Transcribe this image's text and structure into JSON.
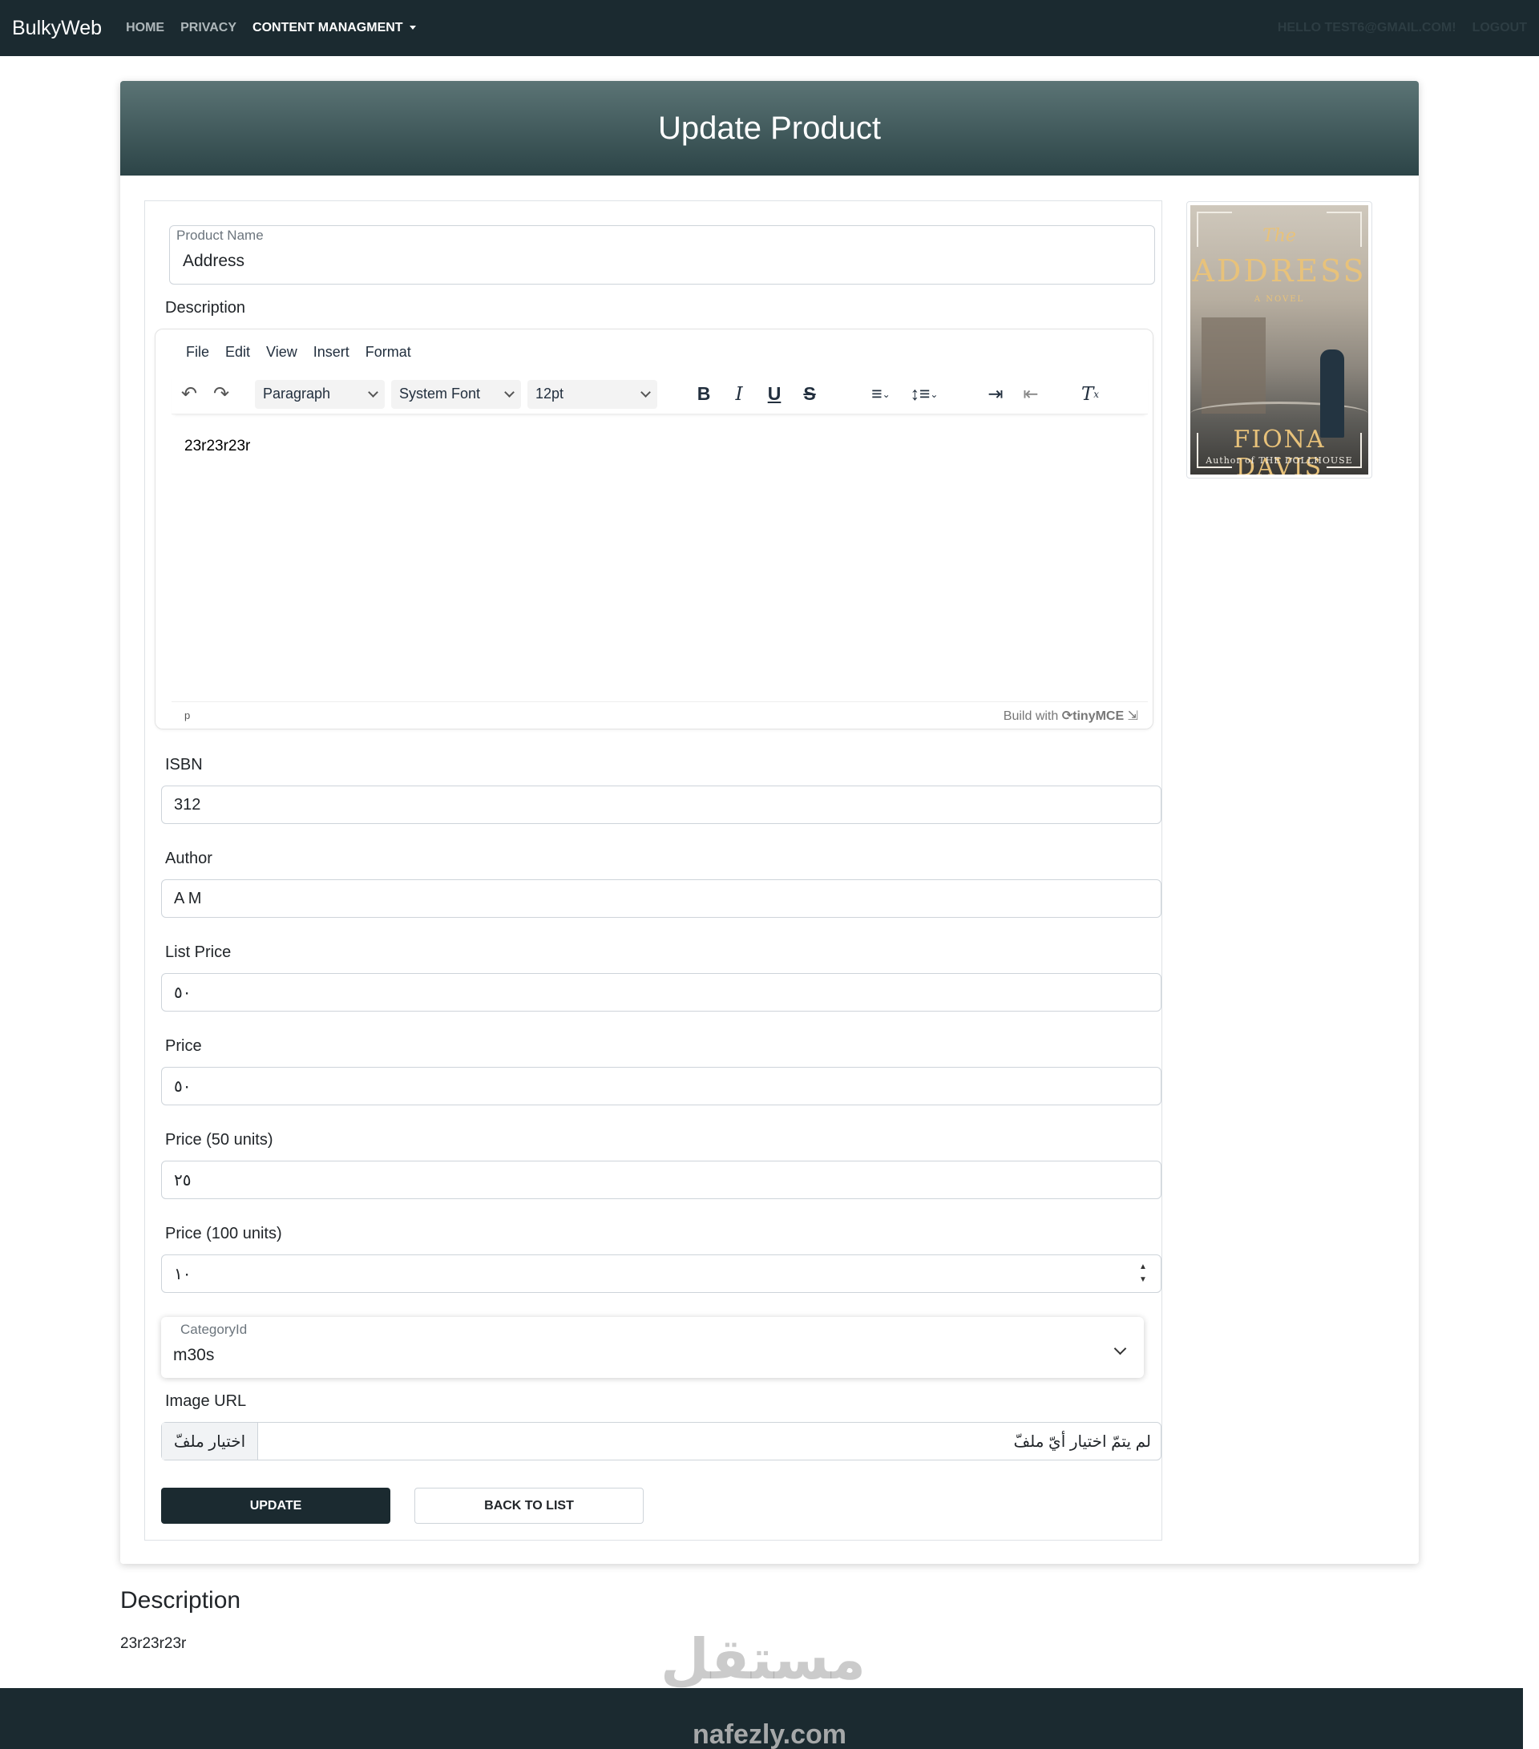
{
  "navbar": {
    "brand": "BulkyWeb",
    "links": [
      "Home",
      "Privacy",
      "Content Managment"
    ],
    "user_greeting": "Hello test6@gmail.com!",
    "logout": "Logout"
  },
  "page": {
    "title": "Update Product"
  },
  "form": {
    "product_name_label": "Product Name",
    "product_name_value": "Address",
    "description_label": "Description",
    "editor": {
      "menu": [
        "File",
        "Edit",
        "View",
        "Insert",
        "Format"
      ],
      "block_format": "Paragraph",
      "font_family": "System Font",
      "font_size": "12pt",
      "content": "23r23r23r",
      "path": "p",
      "branding_prefix": "Build with",
      "branding_name": "tinyMCE"
    },
    "isbn_label": "ISBN",
    "isbn_value": "312",
    "author_label": "Author",
    "author_value": "A M",
    "list_price_label": "List Price",
    "list_price_value": "٥٠",
    "price_label": "Price",
    "price_value": "٥٠",
    "price50_label": "Price (50 units)",
    "price50_value": "٢٥",
    "price100_label": "Price (100 units)",
    "price100_value": "١٠",
    "category_label": "CategoryId",
    "category_value": "m30s",
    "image_url_label": "Image URL",
    "file_button": "اختيار ملفّ",
    "file_status": "لم يتمّ اختيار أيّ ملفّ",
    "update_button": "Update",
    "back_button": "Back To List"
  },
  "book": {
    "the": "The",
    "title": "ADDRESS",
    "subtitle": "A NOVEL",
    "author": "FIONA DAVIS",
    "tagline": "Author of THE DOLLHOUSE"
  },
  "details": {
    "heading": "Description",
    "text": "23r23r23r"
  },
  "watermark": {
    "arabic": "مستقل",
    "latin": "nafezly.com"
  },
  "colors": {
    "navbar": "#1b2a30",
    "header_gradient_top": "#5b7475",
    "header_gradient_bottom": "#2c4447",
    "primary_button": "#1b2a30"
  }
}
